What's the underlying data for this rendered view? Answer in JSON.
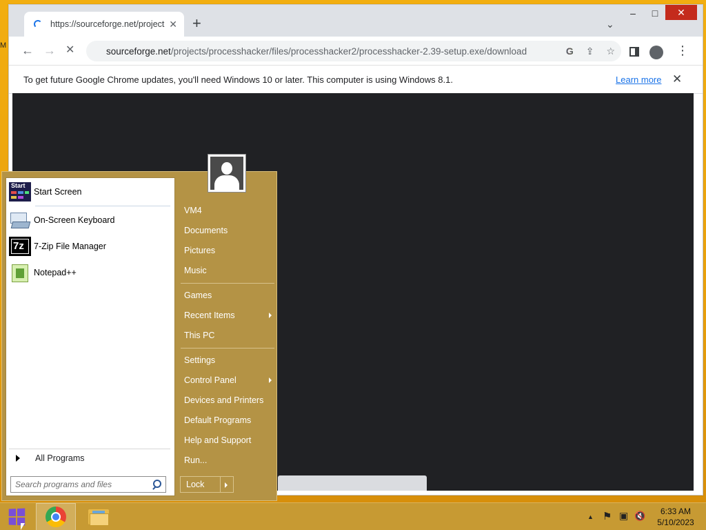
{
  "desktop": {
    "edge_text": "M"
  },
  "browser": {
    "tab_title": "https://sourceforge.net/projects/",
    "tab_close": "✕",
    "new_tab": "+",
    "tab_search": "⌄",
    "window_controls": {
      "minimize": "–",
      "maximize": "□",
      "close": "✕"
    },
    "nav": {
      "back": "←",
      "forward": "→",
      "reload": "✕"
    },
    "url_host": "sourceforge.net",
    "url_path": "/projects/processhacker/files/processhacker2/processhacker-2.39-setup.exe/download",
    "omni_icons": {
      "google": "G",
      "share": "⇪",
      "bookmark": "☆"
    },
    "menu": "⋮",
    "infobar": {
      "message": "To get future Google Chrome updates, you'll need Windows 10 or later. This computer is using Windows 8.1.",
      "learn_more": "Learn more",
      "close": "✕"
    }
  },
  "start_menu": {
    "pinned": [
      {
        "label": "Start Screen",
        "icon": "start-screen-icon"
      },
      {
        "label": "On-Screen Keyboard",
        "icon": "keyboard-icon"
      },
      {
        "label": "7-Zip File Manager",
        "icon": "7zip-icon"
      },
      {
        "label": "Notepad++",
        "icon": "notepadpp-icon"
      }
    ],
    "start_icon_text": "Start",
    "sevenzip_icon_text": "7z",
    "all_programs": "All Programs",
    "search_placeholder": "Search programs and files",
    "right_items": [
      {
        "label": "VM4"
      },
      {
        "label": "Documents"
      },
      {
        "label": "Pictures"
      },
      {
        "label": "Music"
      },
      {
        "label": "Games"
      },
      {
        "label": "Recent Items",
        "submenu": true
      },
      {
        "label": "This PC"
      },
      {
        "label": "Settings"
      },
      {
        "label": "Control Panel",
        "submenu": true
      },
      {
        "label": "Devices and Printers"
      },
      {
        "label": "Default Programs"
      },
      {
        "label": "Help and Support"
      },
      {
        "label": "Run..."
      }
    ],
    "lock_label": "Lock"
  },
  "taskbar": {
    "tray_icons": [
      "chevron-up-icon",
      "flag-icon",
      "network-icon",
      "volume-muted-icon"
    ],
    "tray_glyphs": {
      "chevron": "▲",
      "flag": "⚑",
      "network": "▣",
      "volume": "🔇"
    },
    "time": "6:33 AM",
    "date": "5/10/2023"
  },
  "colors": {
    "desktop": "#f2ae10",
    "start_menu": "#b49345",
    "taskbar": "#c79a33",
    "link": "#1a73e8"
  }
}
